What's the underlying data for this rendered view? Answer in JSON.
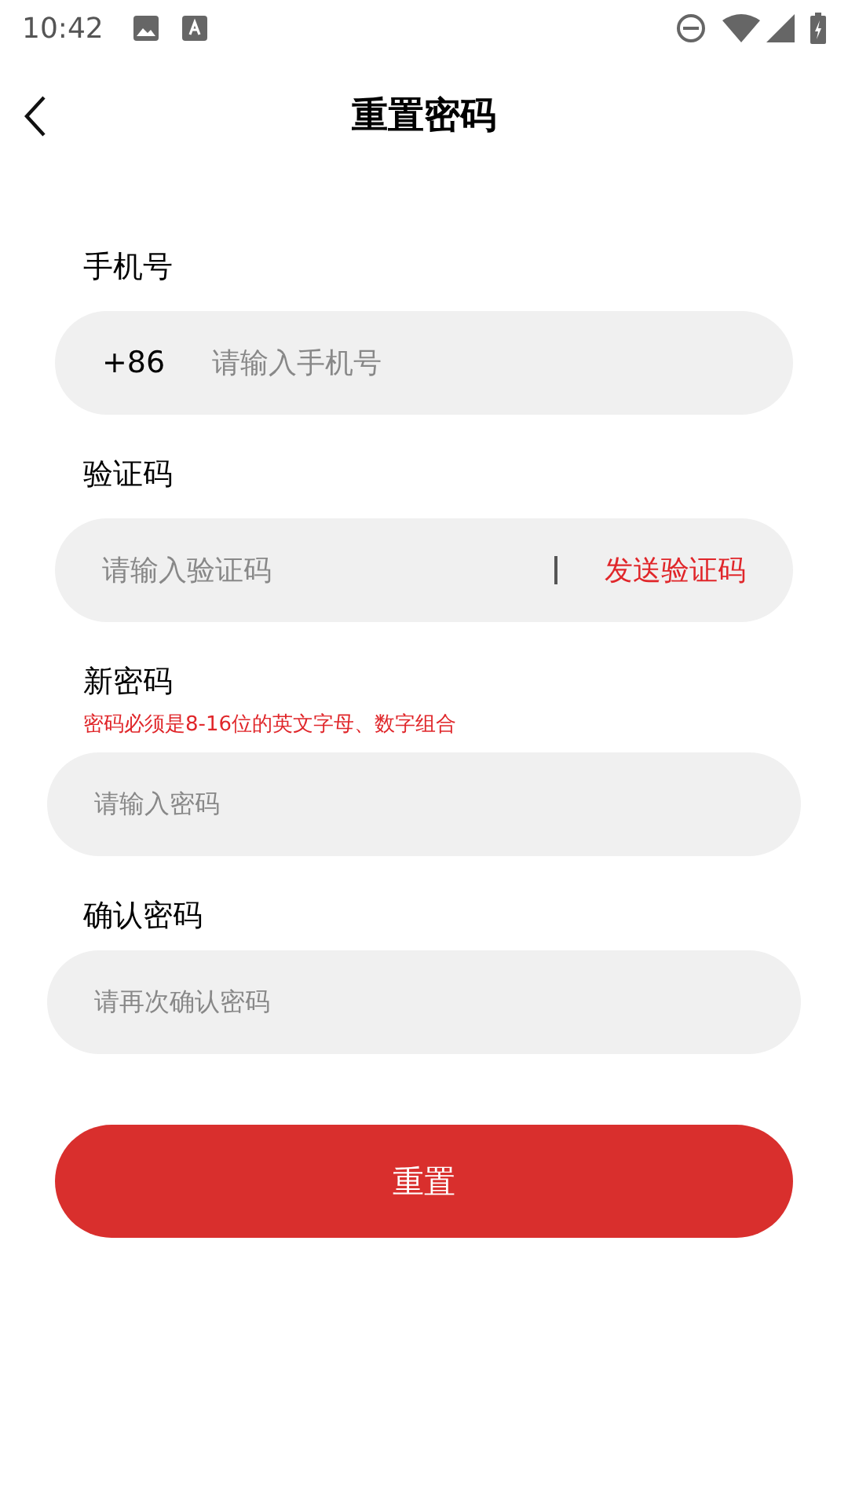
{
  "status_bar": {
    "time": "10:42"
  },
  "header": {
    "title": "重置密码"
  },
  "fields": [
    {
      "label": "手机号",
      "prefix": "+86",
      "placeholder": "请输入手机号",
      "wide": false
    },
    {
      "label": "验证码",
      "placeholder": "请输入验证码",
      "action": "发送验证码",
      "wide": false
    },
    {
      "label": "新密码",
      "hint": "密码必须是8-16位的英文字母、数字组合",
      "placeholder": "请输入密码",
      "wide": true
    },
    {
      "label": "确认密码",
      "placeholder": "请再次确认密码",
      "wide": true
    }
  ],
  "submit": "重置"
}
